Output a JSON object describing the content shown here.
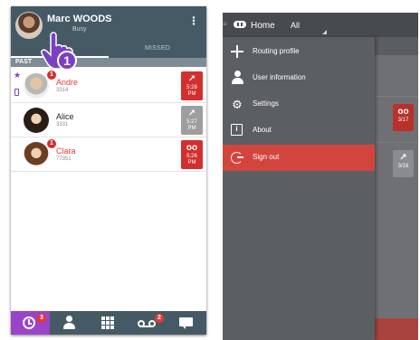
{
  "left_screen": {
    "header": {
      "user_name": "Marc WOODS",
      "status_text": "Busy",
      "menu_glyph": "⋮",
      "missed_tab_label": "MISSED"
    },
    "tutorial_step": "1",
    "section_label": "PAST",
    "calls": [
      {
        "name": "Andre",
        "number": "3314",
        "badge": "1",
        "missed": true,
        "tile_color": "#d32f2f",
        "tile_icon": "phone-missed-icon",
        "tile_glyph": "↗",
        "time": "5:28",
        "ampm": "PM"
      },
      {
        "name": "Alice",
        "number": "3331",
        "badge": "",
        "missed": false,
        "tile_color": "#9e9e9e",
        "tile_icon": "phone-incoming-icon",
        "tile_glyph": "↗",
        "time": "5:27",
        "ampm": "PM"
      },
      {
        "name": "Clara",
        "number": "77351",
        "badge": "1",
        "missed": true,
        "tile_color": "#d32f2f",
        "tile_icon": "voicemail-icon",
        "tile_glyph": "oo",
        "time": "5:26",
        "ampm": "PM"
      }
    ],
    "bottom_nav": {
      "history_badge": "3",
      "voicemail_badge": "2",
      "active_color": "#9b43c9"
    },
    "colors": {
      "header": "#465a66",
      "missed_text": "#e53935"
    }
  },
  "right_screen": {
    "header": {
      "home_label": "Home",
      "filter_label": "All"
    },
    "menu": [
      {
        "label": "Routing profile",
        "icon": "routing-icon"
      },
      {
        "label": "User information",
        "icon": "user-icon"
      },
      {
        "label": "Settings",
        "icon": "gear-icon"
      },
      {
        "label": "About",
        "icon": "info-icon"
      },
      {
        "label": "Sign out",
        "icon": "sign-out-icon",
        "active": true
      }
    ],
    "background_tiles": [
      {
        "glyph": "oo",
        "text": "3/17"
      },
      {
        "glyph": "↗",
        "text": "3/16"
      }
    ],
    "colors": {
      "active_item": "#d2453d",
      "drawer": "#5b5f64"
    }
  }
}
